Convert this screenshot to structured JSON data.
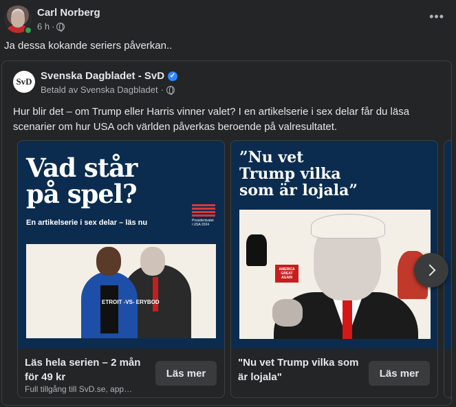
{
  "post": {
    "author": "Carl Norberg",
    "time": "6 h",
    "separator": "·",
    "text": "Ja dessa kokande seriers påverkan..",
    "more_label": "•••"
  },
  "shared": {
    "logo_text": "SvD",
    "page_name": "Svenska Dagbladet - SvD",
    "verified_mark": "✓",
    "sponsored": "Betald av Svenska Dagbladet",
    "separator": "·",
    "description": "Hur blir det – om Trump eller Harris vinner valet? I en artikelserie i sex delar får du läsa scenarier om hur USA och världen påverkas beroende på valresultatet."
  },
  "cards": [
    {
      "image_headline_line1": "Vad står",
      "image_headline_line2": "på spel?",
      "image_subheadline": "En artikelserie i sex delar – läs nu",
      "badge_text_line1": "Presidentvalet",
      "badge_text_line2": "i USA 2024",
      "shirt_text": "ETROIT -VS- ERYBOD",
      "title": "Läs hela serien – 2 mån för 49 kr",
      "subtitle": "Full tillgång till SvD.se, app…",
      "button": "Läs mer"
    },
    {
      "image_headline_line1": "”Nu vet",
      "image_headline_line2": "Trump vilka",
      "image_headline_line3": "som är lojala”",
      "sign_text": "AMERICA GREAT AGAIN",
      "title": "\"Nu vet Trump vilka som är lojala\"",
      "button": "Läs mer"
    }
  ],
  "colors": {
    "background": "#242526",
    "card_image_bg": "#0b2c4f",
    "accent_red": "#d41818",
    "verified_blue": "#2d88ff",
    "online_green": "#31a24c"
  }
}
